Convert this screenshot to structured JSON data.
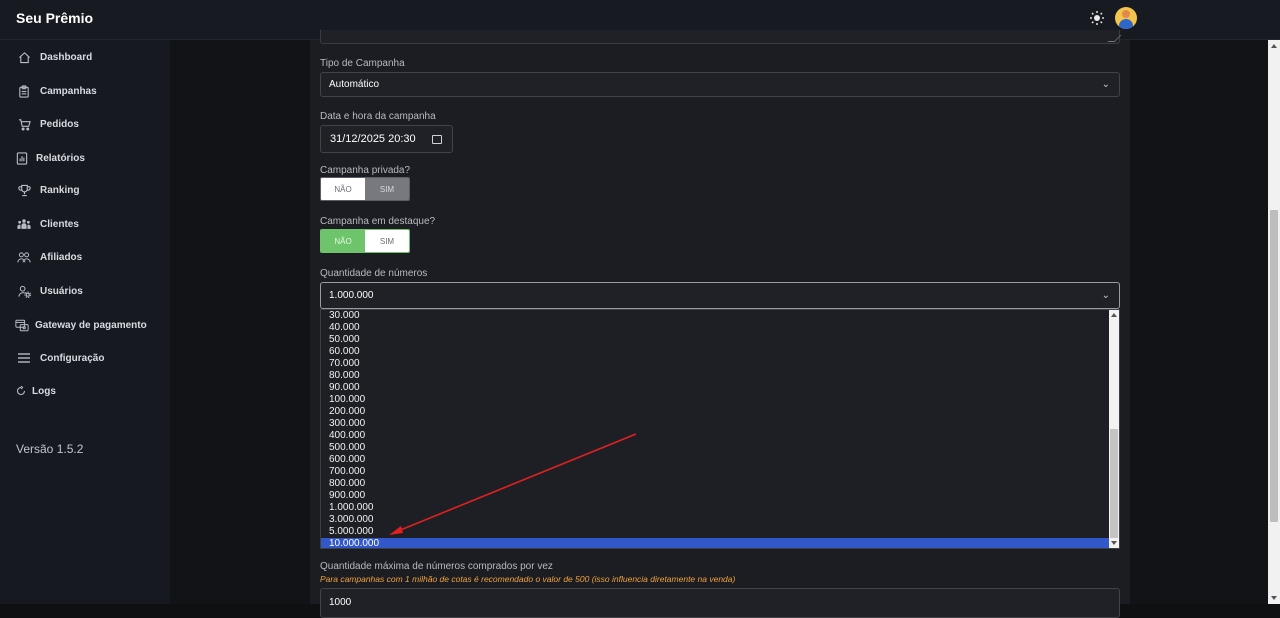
{
  "app": {
    "brand": "Seu Prêmio",
    "theme_icon": "sun-icon",
    "avatar_icon": "user-avatar"
  },
  "sidebar": {
    "items": [
      {
        "label": "Dashboard",
        "icon": "home-icon"
      },
      {
        "label": "Campanhas",
        "icon": "clipboard-icon"
      },
      {
        "label": "Pedidos",
        "icon": "cart-icon"
      },
      {
        "label": "Relatórios",
        "icon": "report-icon"
      },
      {
        "label": "Ranking",
        "icon": "trophy-icon"
      },
      {
        "label": "Clientes",
        "icon": "users-icon"
      },
      {
        "label": "Afiliados",
        "icon": "affiliates-icon"
      },
      {
        "label": "Usuários",
        "icon": "user-gear-icon"
      },
      {
        "label": "Gateway de pagamento",
        "icon": "payment-icon"
      },
      {
        "label": "Configuração",
        "icon": "menu-icon"
      },
      {
        "label": "Logs",
        "icon": "refresh-icon"
      }
    ],
    "version": "Versão 1.5.2"
  },
  "form": {
    "tipo_label": "Tipo de Campanha",
    "tipo_value": "Automático",
    "data_label": "Data e hora da campanha",
    "data_value": "31/12/2025 20:30",
    "privada_label": "Campanha privada?",
    "privada_no": "NÃO",
    "privada_yes": "SIM",
    "destaque_label": "Campanha em destaque?",
    "destaque_no": "NÃO",
    "destaque_yes": "SIM",
    "quantidade_label": "Quantidade de números",
    "quantidade_value": "1.000.000",
    "quantidade_options": [
      "30.000",
      "40.000",
      "50.000",
      "60.000",
      "70.000",
      "80.000",
      "90.000",
      "100.000",
      "200.000",
      "300.000",
      "400.000",
      "500.000",
      "600.000",
      "700.000",
      "800.000",
      "900.000",
      "1.000.000",
      "3.000.000",
      "5.000.000",
      "10.000.000"
    ],
    "quantidade_highlighted": "10.000.000",
    "max_label": "Quantidade máxima de números comprados por vez",
    "max_hint": "Para campanhas com 1 milhão de cotas é recomendado o valor de 500 (isso influencia diretamente na venda)",
    "max_value": "1000"
  },
  "colors": {
    "accent_green": "#6ec46b",
    "highlight_blue": "#3257c9",
    "hint_orange": "#f0a23c",
    "annotation_red": "#e02020"
  }
}
